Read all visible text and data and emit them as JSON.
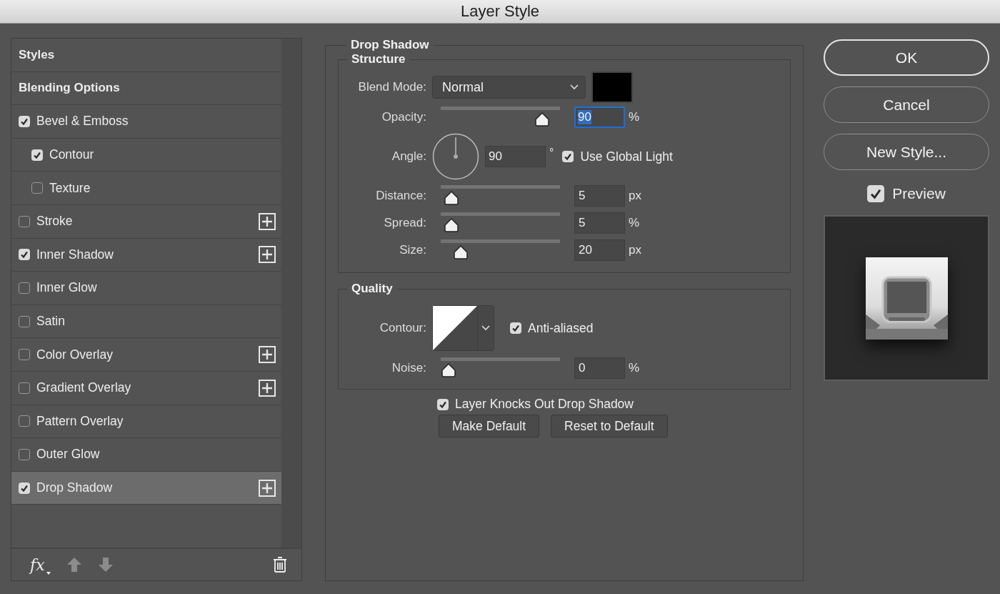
{
  "window": {
    "title": "Layer Style"
  },
  "styles_list": {
    "items": [
      {
        "kind": "header",
        "label": "Styles",
        "selected": false
      },
      {
        "kind": "header",
        "label": "Blending Options",
        "selected": false
      },
      {
        "kind": "effect",
        "label": "Bevel & Emboss",
        "checked": true,
        "selected": false,
        "add_button": false,
        "children": [
          {
            "kind": "effect",
            "label": "Contour",
            "checked": true,
            "selected": false,
            "add_button": false
          },
          {
            "kind": "effect",
            "label": "Texture",
            "checked": false,
            "selected": false,
            "add_button": false
          }
        ]
      },
      {
        "kind": "effect",
        "label": "Stroke",
        "checked": false,
        "selected": false,
        "add_button": true
      },
      {
        "kind": "effect",
        "label": "Inner Shadow",
        "checked": true,
        "selected": false,
        "add_button": true
      },
      {
        "kind": "effect",
        "label": "Inner Glow",
        "checked": false,
        "selected": false,
        "add_button": false
      },
      {
        "kind": "effect",
        "label": "Satin",
        "checked": false,
        "selected": false,
        "add_button": false
      },
      {
        "kind": "effect",
        "label": "Color Overlay",
        "checked": false,
        "selected": false,
        "add_button": true
      },
      {
        "kind": "effect",
        "label": "Gradient Overlay",
        "checked": false,
        "selected": false,
        "add_button": true
      },
      {
        "kind": "effect",
        "label": "Pattern Overlay",
        "checked": false,
        "selected": false,
        "add_button": false
      },
      {
        "kind": "effect",
        "label": "Outer Glow",
        "checked": false,
        "selected": false,
        "add_button": false
      },
      {
        "kind": "effect",
        "label": "Drop Shadow",
        "checked": true,
        "selected": true,
        "add_button": true
      }
    ],
    "footer": {
      "fx_label": "fx"
    }
  },
  "panel": {
    "title": "Drop Shadow",
    "structure": {
      "title": "Structure",
      "blend_mode": {
        "label": "Blend Mode:",
        "value": "Normal"
      },
      "rows": [
        {
          "kind": "slider",
          "label": "Opacity:",
          "value": "90",
          "unit": "%",
          "level": 0.9,
          "focused": true
        },
        {
          "kind": "angle",
          "label": "Angle:",
          "value": "90",
          "unit": "°",
          "global_light": {
            "label": "Use Global Light",
            "checked": true
          }
        },
        {
          "kind": "slider",
          "label": "Distance:",
          "value": "5",
          "unit": "px",
          "level": 0.03,
          "focused": false
        },
        {
          "kind": "slider",
          "label": "Spread:",
          "value": "5",
          "unit": "%",
          "level": 0.03,
          "focused": false
        },
        {
          "kind": "slider",
          "label": "Size:",
          "value": "20",
          "unit": "px",
          "level": 0.12,
          "focused": false
        }
      ]
    },
    "quality": {
      "title": "Quality",
      "contour_label": "Contour:",
      "anti_aliased": {
        "label": "Anti-aliased",
        "checked": true
      },
      "noise": {
        "label": "Noise:",
        "value": "0",
        "unit": "%",
        "level": 0,
        "focused": false
      }
    },
    "knockout": {
      "label": "Layer Knocks Out Drop Shadow",
      "checked": true
    },
    "buttons": [
      "Make Default",
      "Reset to Default"
    ]
  },
  "actions": [
    {
      "label": "OK",
      "kind": "primary"
    },
    {
      "label": "Cancel",
      "kind": "normal"
    },
    {
      "label": "New Style...",
      "kind": "normal"
    }
  ],
  "preview": {
    "label": "Preview",
    "checked": true
  }
}
